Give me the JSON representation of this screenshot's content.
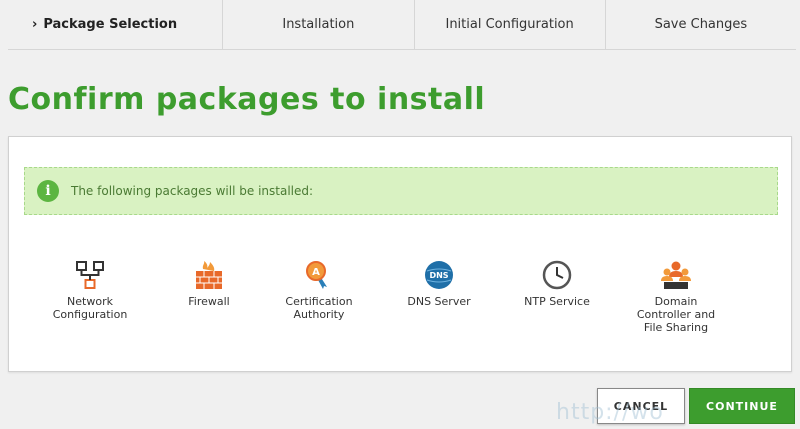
{
  "steps": [
    {
      "label": "Package Selection",
      "active": true
    },
    {
      "label": "Installation"
    },
    {
      "label": "Initial Configuration"
    },
    {
      "label": "Save Changes"
    }
  ],
  "page_title": "Confirm packages to install",
  "info": {
    "icon": "info-icon",
    "text": "The following packages will be installed:"
  },
  "packages": [
    {
      "label": "Network\nConfiguration",
      "icon": "network-icon"
    },
    {
      "label": "Firewall",
      "icon": "firewall-icon"
    },
    {
      "label": "Certification\nAuthority",
      "icon": "certificate-icon"
    },
    {
      "label": "DNS Server",
      "icon": "dns-icon"
    },
    {
      "label": "NTP Service",
      "icon": "clock-icon"
    },
    {
      "label": "Domain\nController and\nFile Sharing",
      "icon": "users-icon"
    }
  ],
  "buttons": {
    "cancel": "CANCEL",
    "continue": "CONTINUE"
  },
  "watermark": "http://wo",
  "colors": {
    "accent": "#3d9d2e",
    "info_bg": "#d9f2c2",
    "icon_orange": "#e8692a",
    "dns_blue": "#1f6fa8"
  }
}
